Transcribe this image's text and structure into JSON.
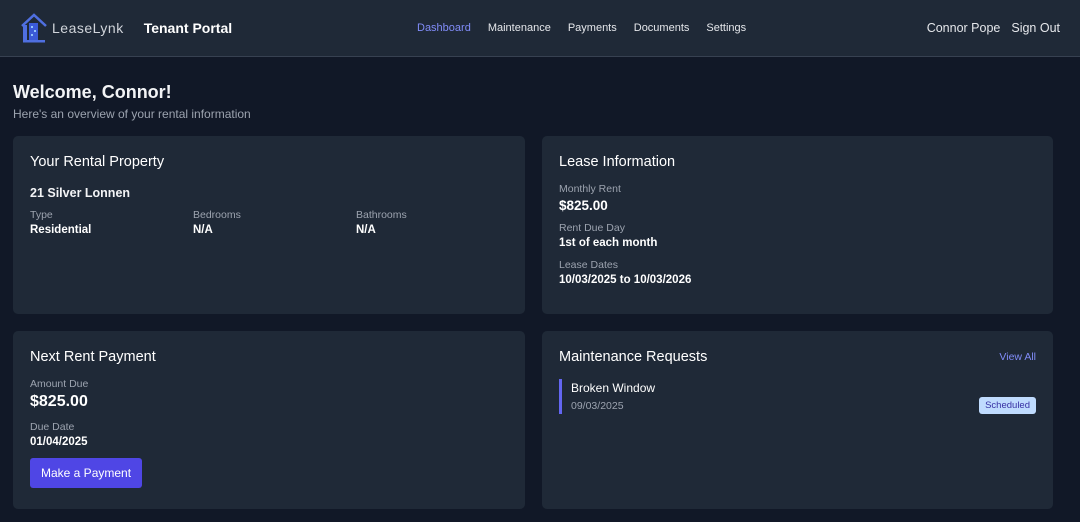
{
  "header": {
    "logo_text": "LeaseLynk",
    "portal_title": "Tenant Portal",
    "nav": [
      {
        "label": "Dashboard",
        "active": true
      },
      {
        "label": "Maintenance"
      },
      {
        "label": "Payments"
      },
      {
        "label": "Documents"
      },
      {
        "label": "Settings"
      }
    ],
    "user_name": "Connor Pope",
    "sign_out": "Sign Out"
  },
  "welcome": {
    "title": "Welcome, Connor!",
    "subtitle": "Here's an overview of your rental information"
  },
  "property": {
    "title": "Your Rental Property",
    "address": "21 Silver Lonnen",
    "type_label": "Type",
    "type": "Residential",
    "bedrooms_label": "Bedrooms",
    "bedrooms": "N/A",
    "bathrooms_label": "Bathrooms",
    "bathrooms": "N/A"
  },
  "lease": {
    "title": "Lease Information",
    "rent_label": "Monthly Rent",
    "rent": "$825.00",
    "due_label": "Rent Due Day",
    "due": "1st of each month",
    "dates_label": "Lease Dates",
    "dates": "10/03/2025 to 10/03/2026"
  },
  "payment": {
    "title": "Next Rent Payment",
    "amount_label": "Amount Due",
    "amount": "$825.00",
    "date_label": "Due Date",
    "date": "01/04/2025",
    "button": "Make a Payment"
  },
  "maintenance": {
    "title": "Maintenance Requests",
    "view_all": "View All",
    "items": [
      {
        "title": "Broken Window",
        "date": "09/03/2025",
        "status": "Scheduled"
      }
    ]
  }
}
